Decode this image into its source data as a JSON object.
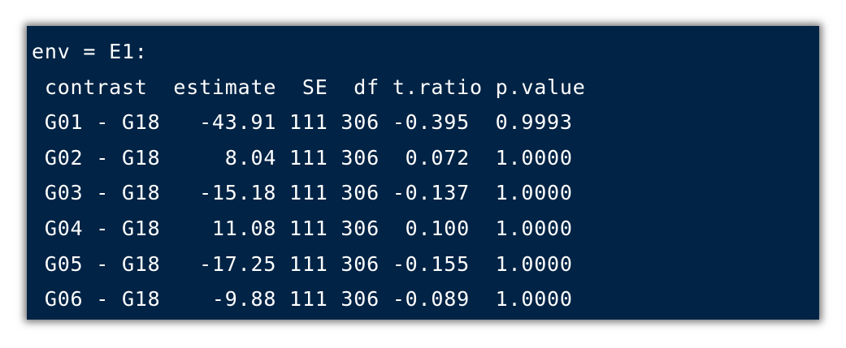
{
  "console": {
    "lines": [
      "env = E1:",
      " contrast  estimate  SE  df t.ratio p.value",
      " G01 - G18   -43.91 111 306 -0.395  0.9993",
      " G02 - G18     8.04 111 306  0.072  1.0000",
      " G03 - G18   -15.18 111 306 -0.137  1.0000",
      " G04 - G18    11.08 111 306  0.100  1.0000",
      " G05 - G18   -17.25 111 306 -0.155  1.0000",
      " G06 - G18    -9.88 111 306 -0.089  1.0000"
    ]
  },
  "colors": {
    "background": "#012345",
    "text": "#ffffff"
  }
}
